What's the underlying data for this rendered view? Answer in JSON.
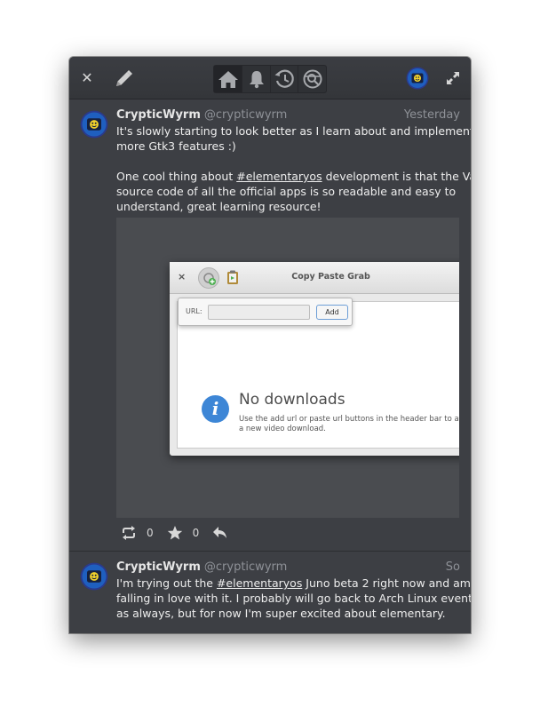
{
  "colors": {
    "window_bg": "#3d3f44",
    "headerbar_bg": "#36383c",
    "text_primary": "#eeeeee",
    "text_secondary": "#8e9197",
    "info_blue": "#3d86d6"
  },
  "headerbar": {
    "close_icon": "close-icon",
    "compose_icon": "pencil-icon",
    "nav": [
      {
        "icon": "home-icon",
        "active": true
      },
      {
        "icon": "bell-icon",
        "active": false
      },
      {
        "icon": "history-icon",
        "active": false
      },
      {
        "icon": "search-icon",
        "active": false
      }
    ],
    "account_icon": "avatar",
    "expand_icon": "expand-icon"
  },
  "tweets": [
    {
      "name": "CrypticWyrm",
      "handle": "@crypticwyrm",
      "time": "Yesterday",
      "text_lines": [
        "It's slowly starting to look better as I learn about and implement",
        "more Gtk3 features :)",
        "",
        "One cool thing about ",
        "#elementaryos",
        " development is that the Vala",
        "source code of all the official apps is so readable and easy to",
        "understand, great learning resource!"
      ],
      "retweets": "0",
      "favorites": "0",
      "media": {
        "app_title": "Copy Paste Grab",
        "close": "×",
        "url_label": "URL:",
        "url_value": "",
        "add_button": "Add",
        "empty_title": "No downloads",
        "empty_desc": "Use the add url or paste url buttons in the header bar to add a new video download."
      }
    },
    {
      "name": "CrypticWyrm",
      "handle": "@crypticwyrm",
      "time": "So",
      "text_lines": [
        "I'm trying out the ",
        "#elementaryos",
        " Juno beta 2 right now and am",
        "falling in love with it. I probably will go back to Arch Linux eventually,",
        "as always, but for now I'm super excited about elementary."
      ]
    }
  ]
}
